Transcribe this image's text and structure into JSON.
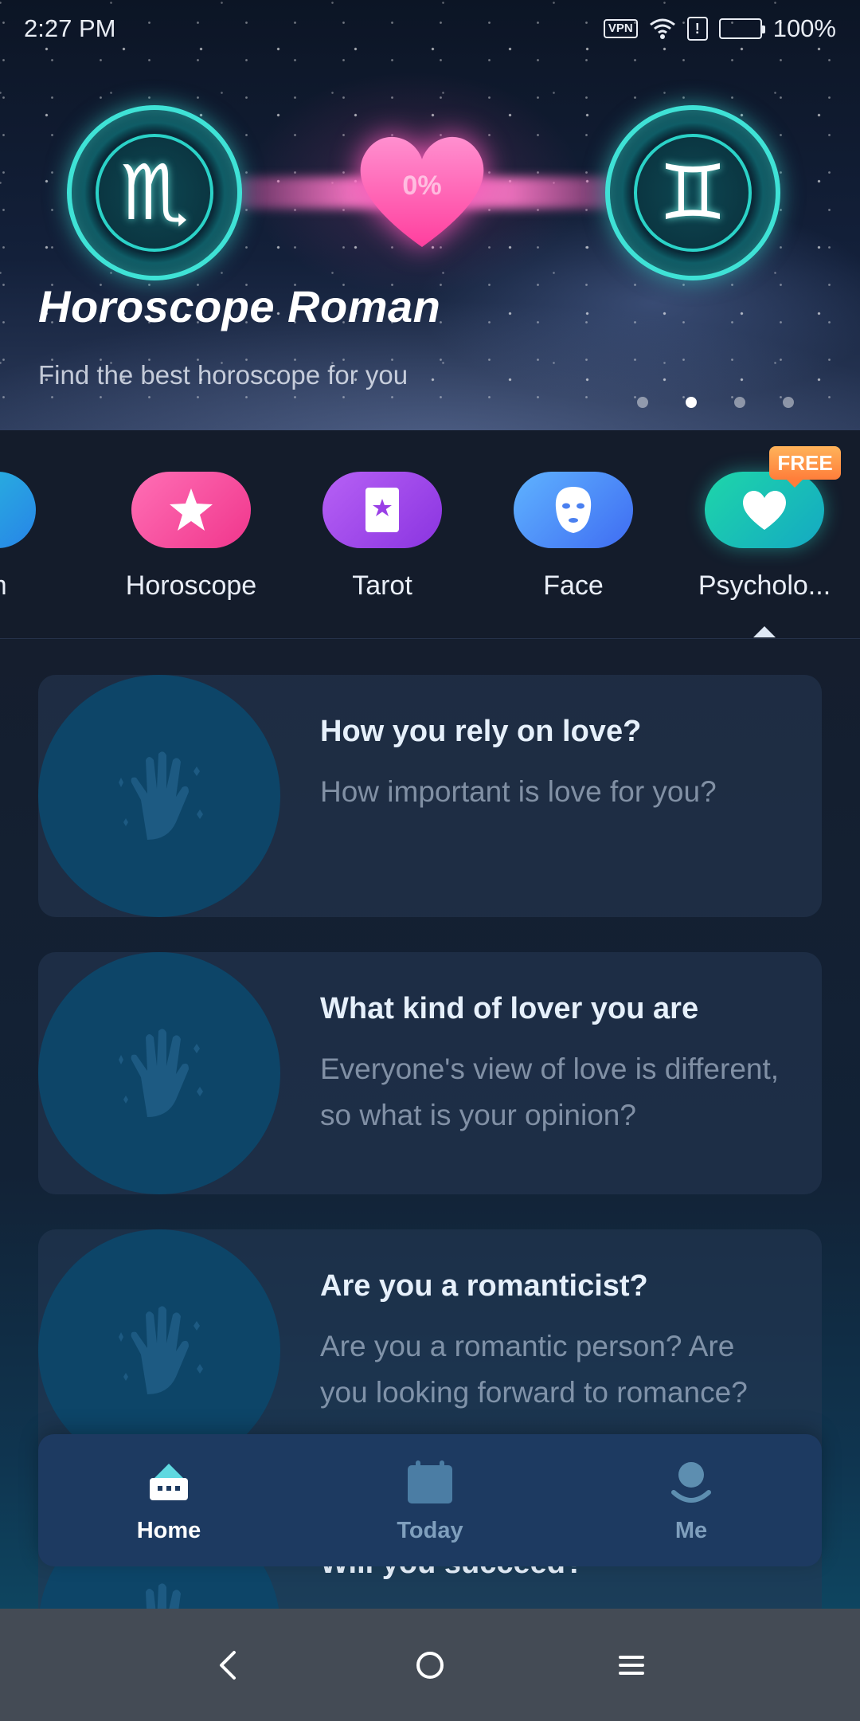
{
  "status_bar": {
    "time": "2:27 PM",
    "vpn": "VPN",
    "battery": "100%"
  },
  "hero": {
    "title": "Horoscope Roman",
    "subtitle": "Find the best horoscope for you",
    "match_percent": "0%",
    "left_sign": "♏",
    "right_sign": "♊",
    "carousel_pages": 4,
    "carousel_active_index": 1
  },
  "categories": {
    "items": [
      {
        "label": "Palm",
        "icon": "palm-icon"
      },
      {
        "label": "Horoscope",
        "icon": "star-icon"
      },
      {
        "label": "Tarot",
        "icon": "tarot-card-icon"
      },
      {
        "label": "Face",
        "icon": "face-mask-icon"
      },
      {
        "label": "Psycholo...",
        "icon": "heart-icon"
      }
    ],
    "free_badge": "FREE",
    "selected": "Psycholo..."
  },
  "tests": [
    {
      "title": "How you rely on love?",
      "description": "How important is love for you?"
    },
    {
      "title": "What kind of lover you are",
      "description": "Everyone's view of love is different, so what is your opinion?"
    },
    {
      "title": "Are you a romanticist?",
      "description": "Are you a romantic person? Are you looking forward to romance?"
    },
    {
      "title": "Will you succeed?",
      "description": ""
    }
  ],
  "tab_bar": {
    "home": "Home",
    "today": "Today",
    "me": "Me",
    "active": "Home"
  },
  "colors": {
    "accent_teal": "#3fe2d6",
    "heart_pink": "#ff5fb4",
    "free_badge": "#ff8a3d",
    "tab_bar": "#1d3a61"
  }
}
